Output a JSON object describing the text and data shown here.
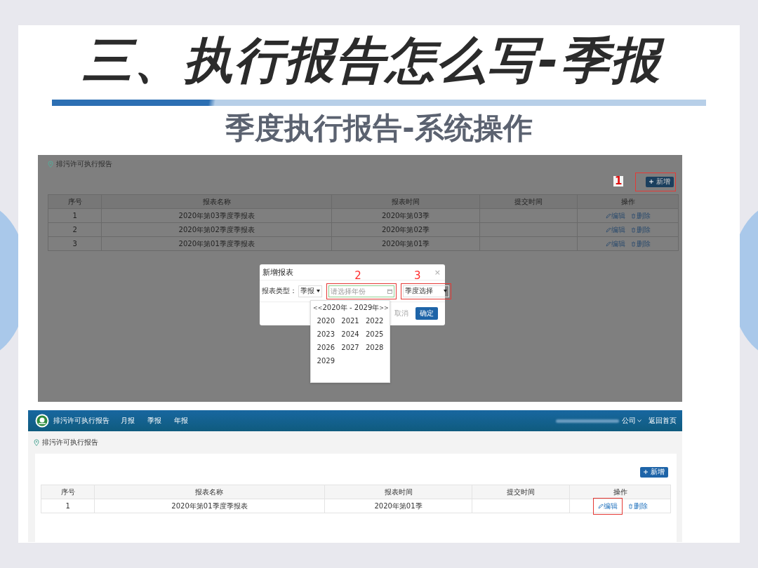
{
  "slide": {
    "title": "三、执行报告怎么写-季报",
    "subtitle": "季度执行报告-系统操作"
  },
  "screenshot_1": {
    "breadcrumb": "排污许可执行报告",
    "add_button": {
      "label": "新增",
      "annotation": "1"
    },
    "columns": [
      "序号",
      "报表名称",
      "报表时间",
      "提交时间",
      "操作"
    ],
    "rows": [
      {
        "index": "1",
        "name": "2020年第03季度季报表",
        "period": "2020年第03季",
        "submitted": "",
        "edit": "编辑",
        "delete": "删除",
        "highlighted": false
      },
      {
        "index": "2",
        "name": "2020年第02季度季报表",
        "period": "2020年第02季",
        "submitted": "",
        "edit": "编辑",
        "delete": "删除",
        "highlighted": false
      },
      {
        "index": "3",
        "name": "2020年第01季度季报表",
        "period": "2020年第01季",
        "submitted": "",
        "edit": "编辑",
        "delete": "删除",
        "highlighted": false
      }
    ],
    "dialog": {
      "title": "新增报表",
      "close": "×",
      "type_label": "报表类型：",
      "type_select": "季报",
      "year_field": {
        "placeholder": "请选择年份",
        "annotation": "2"
      },
      "quarter_select": {
        "value": "季度选择",
        "annotation": "3"
      },
      "cancel": "取消",
      "ok": "确定",
      "calendar": {
        "prev": "<<",
        "range": "2020年 - 2029年",
        "next": ">>",
        "years": [
          "2020",
          "2021",
          "2022",
          "2023",
          "2024",
          "2025",
          "2026",
          "2027",
          "2028",
          "2029"
        ]
      }
    }
  },
  "screenshot_2": {
    "app_title": "排污许可执行报告",
    "menu": [
      "月报",
      "季报",
      "年报"
    ],
    "company": "公司",
    "home_link": "返回首页",
    "breadcrumb": "排污许可执行报告",
    "add_button": {
      "label": "新增"
    },
    "columns": [
      "序号",
      "报表名称",
      "报表时间",
      "提交时间",
      "操作"
    ],
    "rows": [
      {
        "index": "1",
        "name": "2020年第01季度季报表",
        "period": "2020年第01季",
        "submitted": "",
        "edit": "编辑",
        "delete": "删除",
        "highlighted": true
      }
    ]
  }
}
